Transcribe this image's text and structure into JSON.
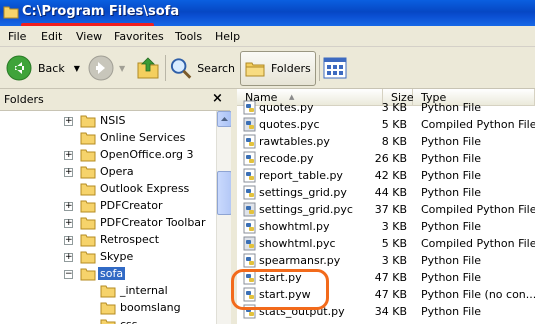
{
  "window": {
    "title": "C:\\Program Files\\sofa"
  },
  "menu": [
    "File",
    "Edit",
    "View",
    "Favorites",
    "Tools",
    "Help"
  ],
  "toolbar": {
    "back_label": "Back",
    "search_label": "Search",
    "folders_label": "Folders"
  },
  "folders_pane": {
    "header": "Folders",
    "close_glyph": "×",
    "items": [
      {
        "label": "NSIS",
        "expander": "+"
      },
      {
        "label": "Online Services",
        "expander": ""
      },
      {
        "label": "OpenOffice.org 3",
        "expander": "+"
      },
      {
        "label": "Opera",
        "expander": "+"
      },
      {
        "label": "Outlook Express",
        "expander": ""
      },
      {
        "label": "PDFCreator",
        "expander": "+"
      },
      {
        "label": "PDFCreator Toolbar",
        "expander": "+"
      },
      {
        "label": "Retrospect",
        "expander": "+"
      },
      {
        "label": "Skype",
        "expander": "+"
      },
      {
        "label": "sofa",
        "expander": "−",
        "selected": true
      },
      {
        "label": "_internal",
        "expander": "",
        "child": true
      },
      {
        "label": "boomslang",
        "expander": "",
        "child": true
      },
      {
        "label": "css",
        "expander": "",
        "child": true
      }
    ]
  },
  "file_list": {
    "columns": {
      "name": "Name",
      "size": "Size",
      "type": "Type"
    },
    "sort_indicator": "▲",
    "rows": [
      {
        "name": "quotes.py",
        "size": "3 KB",
        "type": "Python File",
        "kind": "py"
      },
      {
        "name": "quotes.pyc",
        "size": "5 KB",
        "type": "Compiled Python File",
        "kind": "pyc"
      },
      {
        "name": "rawtables.py",
        "size": "8 KB",
        "type": "Python File",
        "kind": "py"
      },
      {
        "name": "recode.py",
        "size": "26 KB",
        "type": "Python File",
        "kind": "py"
      },
      {
        "name": "report_table.py",
        "size": "42 KB",
        "type": "Python File",
        "kind": "py"
      },
      {
        "name": "settings_grid.py",
        "size": "44 KB",
        "type": "Python File",
        "kind": "py"
      },
      {
        "name": "settings_grid.pyc",
        "size": "37 KB",
        "type": "Compiled Python File",
        "kind": "pyc"
      },
      {
        "name": "showhtml.py",
        "size": "3 KB",
        "type": "Python File",
        "kind": "py"
      },
      {
        "name": "showhtml.pyc",
        "size": "5 KB",
        "type": "Compiled Python File",
        "kind": "pyc"
      },
      {
        "name": "spearmansr.py",
        "size": "3 KB",
        "type": "Python File",
        "kind": "py"
      },
      {
        "name": "start.py",
        "size": "47 KB",
        "type": "Python File",
        "kind": "py"
      },
      {
        "name": "start.pyw",
        "size": "47 KB",
        "type": "Python File (no con...",
        "kind": "py"
      },
      {
        "name": "stats_output.py",
        "size": "34 KB",
        "type": "Python File",
        "kind": "py"
      }
    ]
  },
  "colors": {
    "title_bar": "#0a5fe0",
    "selection": "#316ac5",
    "annotation_underline": "#f01f1f",
    "annotation_ring": "#f26a1b"
  }
}
